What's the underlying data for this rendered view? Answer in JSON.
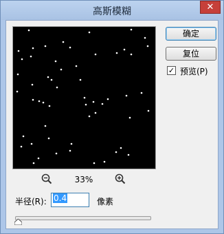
{
  "window": {
    "title": "高斯模糊",
    "close_glyph": "✕"
  },
  "buttons": {
    "ok": "确定",
    "reset": "复位"
  },
  "preview": {
    "label": "预览(P)",
    "checked": true,
    "check_glyph": "✓"
  },
  "zoom": {
    "value": "33%",
    "out_icon": "zoom-out-icon",
    "in_icon": "zoom-in-icon"
  },
  "radius": {
    "label": "半径(R):",
    "value": "0.4",
    "unit": "像素",
    "slider_fraction": 0.0
  },
  "colors": {
    "preview_background": "#000000",
    "star_color": "#ffffff",
    "title_bar": "#adc6e8",
    "close_button": "#c6403a"
  }
}
